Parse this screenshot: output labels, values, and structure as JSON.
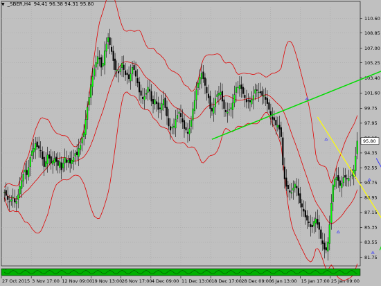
{
  "window": {
    "symbol": "_SBER,H4",
    "ohlc": "94.41 96.38 94.31 95.80"
  },
  "indicator_label": "...",
  "colors": {
    "background": "#c0c0c0",
    "grid": "#a9a9a9",
    "bull_candle": "#00ff00",
    "bear_candle": "#000000",
    "bollinger": "#e00000",
    "trend_green": "#00dd00",
    "trend_yellow": "#ffff00",
    "trend_blue": "#3333ff",
    "indicator_bg": "#00b000"
  },
  "chart_data": {
    "type": "candlestick",
    "y_range": [
      80.7,
      112.0
    ],
    "y_ticks": [
      "110.60",
      "108.85",
      "107.00",
      "105.25",
      "103.40",
      "101.60",
      "99.75",
      "97.95",
      "96.15",
      "94.35",
      "92.55",
      "90.75",
      "88.95",
      "87.15",
      "85.35",
      "83.55",
      "81.75"
    ],
    "last_price": "95.80",
    "x_ticks": [
      "27 Oct 2015",
      "3 Nov 17:00",
      "12 Nov 09:00",
      "19 Nov 13:00",
      "26 Nov 17:00",
      "4 Dec 09:00",
      "11 Dec 13:00",
      "18 Dec 17:00",
      "28 Dec 09:00",
      "6 Jan 13:00",
      "15 Jan 17:00",
      "25 Jan 09:00"
    ],
    "closes": [
      89.6,
      89.2,
      88.7,
      88.4,
      88.7,
      89.0,
      88.4,
      88.5,
      89.3,
      90.3,
      91.0,
      91.8,
      92.3,
      91.7,
      92.6,
      93.8,
      94.6,
      94.9,
      95.5,
      95.1,
      94.9,
      94.6,
      93.6,
      92.7,
      93.3,
      94.1,
      93.7,
      93.1,
      93.4,
      93.7,
      93.3,
      92.8,
      93.3,
      92.3,
      93.1,
      93.8,
      93.2,
      93.5,
      93.1,
      93.5,
      93.8,
      94.3,
      94.1,
      94.9,
      95.3,
      96.2,
      96.8,
      98.4,
      99.9,
      101.1,
      102.6,
      103.6,
      104.5,
      105.3,
      106.0,
      105.7,
      104.7,
      105.2,
      106.7,
      107.5,
      108.3,
      107.4,
      106.6,
      105.5,
      104.4,
      104.4,
      104.0,
      104.5,
      105.2,
      104.4,
      103.8,
      103.8,
      103.3,
      103.9,
      104.7,
      104.4,
      103.6,
      102.8,
      101.7,
      101.3,
      100.9,
      101.2,
      101.6,
      102.3,
      101.8,
      100.6,
      100.3,
      100.8,
      100.3,
      99.6,
      99.7,
      100.3,
      100.8,
      99.8,
      98.8,
      97.6,
      97.1,
      97.5,
      97.6,
      98.4,
      98.9,
      99.3,
      98.7,
      98.1,
      97.3,
      97.1,
      96.7,
      97.3,
      98.3,
      99.7,
      100.7,
      102.0,
      102.8,
      103.5,
      104.0,
      103.3,
      102.5,
      101.6,
      101.0,
      99.7,
      99.4,
      99.9,
      100.9,
      101.4,
      101.6,
      101.7,
      100.6,
      99.7,
      99.3,
      99.3,
      99.6,
      99.8,
      100.4,
      101.4,
      102.3,
      102.3,
      102.5,
      102.1,
      101.5,
      101.0,
      100.5,
      100.6,
      100.5,
      100.8,
      101.3,
      102.0,
      101.9,
      101.7,
      101.6,
      101.3,
      101.3,
      100.8,
      100.3,
      99.6,
      98.8,
      98.4,
      98.3,
      97.7,
      97.7,
      97.2,
      96.3,
      92.9,
      91.2,
      90.3,
      90.0,
      89.6,
      89.6,
      90.1,
      90.6,
      90.1,
      89.2,
      88.3,
      87.8,
      87.3,
      86.6,
      86.2,
      85.9,
      85.4,
      85.4,
      86.1,
      86.4,
      85.7,
      85.1,
      84.0,
      83.4,
      82.7,
      82.6,
      83.6,
      85.7,
      88.3,
      90.5,
      91.2,
      91.4,
      91.0,
      90.4,
      90.7,
      91.4,
      91.4,
      91.2,
      91.3,
      91.5,
      91.7,
      92.3,
      94.0,
      95.8
    ]
  }
}
